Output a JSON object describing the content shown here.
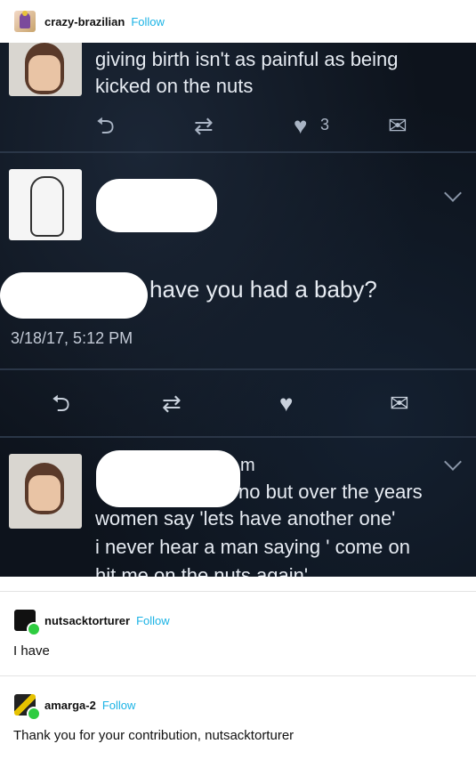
{
  "post": {
    "author": "crazy-brazilian",
    "follow_label": "Follow"
  },
  "screenshot": {
    "tweet1_text_line1": "giving birth isn't as painful as being",
    "tweet1_text_line2": "kicked on the nuts",
    "tweet1_like_count": "3",
    "tweet2_text": "have you had a baby?",
    "tweet2_timestamp": "3/18/17, 5:12 PM",
    "tweet3_partial_name": "m",
    "tweet3_line1": "no but over the years",
    "tweet3_line2": "women say 'lets have another one'",
    "tweet3_line3": "i never hear a man saying ' come on",
    "tweet3_line4": "hit me on the nuts again'"
  },
  "reblogs": [
    {
      "author": "nutsacktorturer",
      "follow_label": "Follow",
      "text": "I have"
    },
    {
      "author": "amarga-2",
      "follow_label": "Follow",
      "text": "Thank you for your contribution, nutsacktorturer"
    }
  ],
  "icons": {
    "reply": "reply-icon",
    "retweet": "retweet-icon",
    "like": "heart-icon",
    "dm": "envelope-icon",
    "expand": "chevron-down-icon"
  }
}
